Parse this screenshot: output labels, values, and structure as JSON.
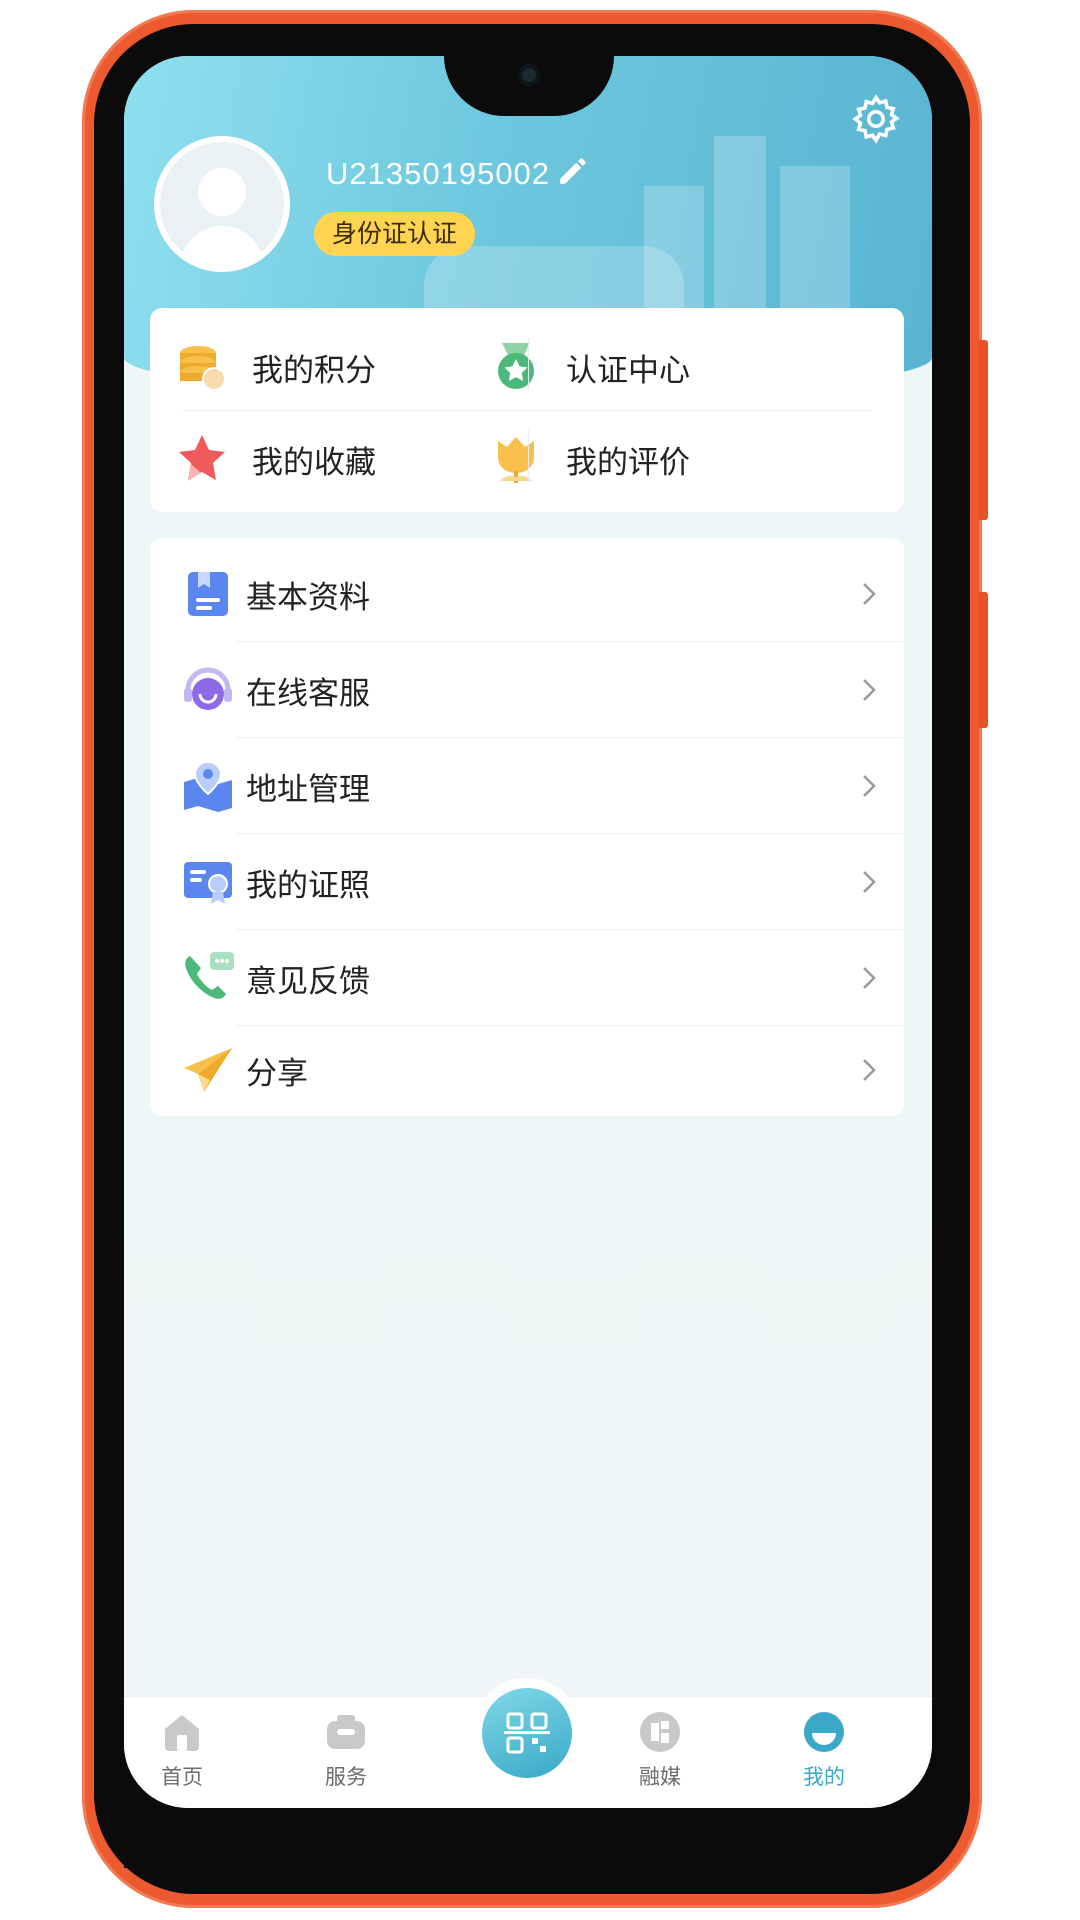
{
  "profile": {
    "username": "U21350195002",
    "id_badge": "身份证认证"
  },
  "quick": {
    "points": "我的积分",
    "cert_center": "认证中心",
    "favorites": "我的收藏",
    "reviews": "我的评价"
  },
  "menu": [
    {
      "label": "基本资料"
    },
    {
      "label": "在线客服"
    },
    {
      "label": "地址管理"
    },
    {
      "label": "我的证照"
    },
    {
      "label": "意见反馈"
    },
    {
      "label": "分享"
    }
  ],
  "nav": {
    "home": "首页",
    "services": "服务",
    "media": "融媒",
    "mine": "我的"
  },
  "colors": {
    "frame": "#ee5a2f",
    "header_start": "#8fe0ef",
    "header_end": "#58b4d1",
    "badge": "#ffd451",
    "active_nav": "#3aa8c7"
  }
}
